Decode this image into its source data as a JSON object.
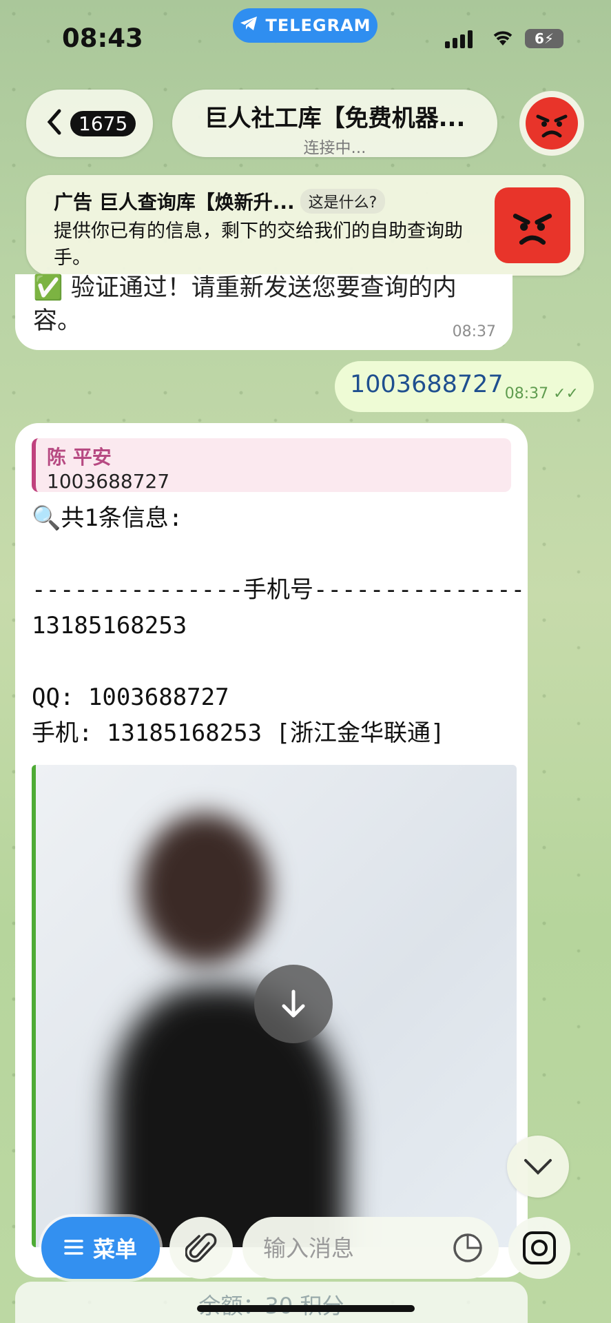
{
  "status_bar": {
    "time": "08:43",
    "app_pill": "TELEGRAM",
    "battery": "6"
  },
  "header": {
    "back_count": "1675",
    "title": "巨人社工库【免费机器...",
    "subtitle": "连接中..."
  },
  "ad": {
    "title": "广告 巨人查询库【焕新升...",
    "what_label": "这是什么?",
    "body": "提供你已有的信息，剩下的交给我们的自助查询助手。"
  },
  "messages": {
    "incoming_text": "✅ 验证通过！请重新发送您要查询的内容。",
    "incoming_time": "08:37",
    "outgoing_text": "1003688727",
    "outgoing_time": "08:37",
    "reply_name": "陈 平安",
    "reply_text": "1003688727",
    "result_lines": "🔍共1条信息:\n\n---------------手机号---------------\n13185168253\n\nQQ: 1003688727\n手机: 13185168253 [浙江金华联通]"
  },
  "composer": {
    "menu_label": "菜单",
    "placeholder": "输入消息"
  },
  "footer": {
    "balance_text": "余额：30 积分"
  },
  "colors": {
    "accent": "#3390f0",
    "quote_accent": "#c0427e",
    "photo_accent": "#4eab35"
  }
}
